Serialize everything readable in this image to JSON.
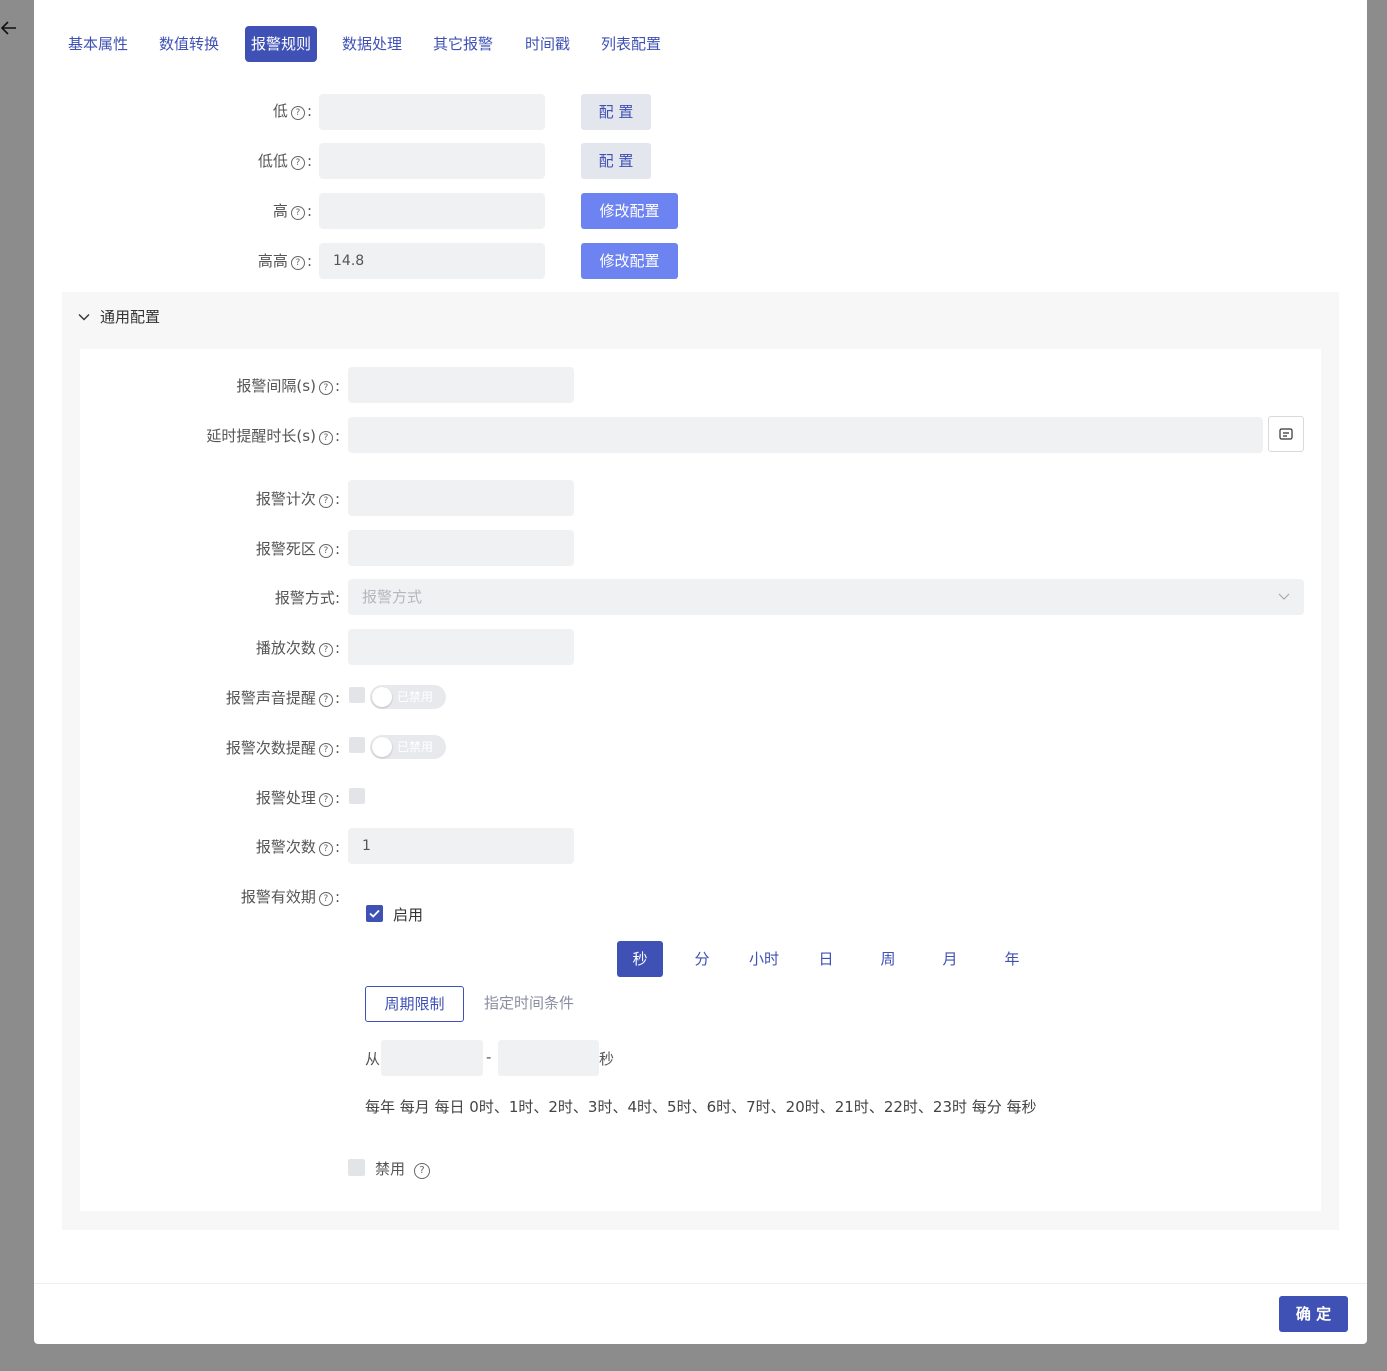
{
  "tabs": [
    "基本属性",
    "数值转换",
    "报警规则",
    "数据处理",
    "其它报警",
    "时间戳",
    "列表配置"
  ],
  "thresholds": [
    {
      "label": "低",
      "value": "",
      "button": "配 置"
    },
    {
      "label": "低低",
      "value": "",
      "button": "配 置"
    },
    {
      "label": "高",
      "value": "",
      "button": "修改配置"
    },
    {
      "label": "高高",
      "value": "14.8",
      "button": "修改配置"
    }
  ],
  "help_glyph": "?",
  "colon": ":",
  "general": {
    "title": "通用配置",
    "alarm_interval_label": "报警间隔(s)",
    "delay_remind_label": "延时提醒时长(s)",
    "alarm_count_label": "报警计次",
    "alarm_deadband_label": "报警死区",
    "alarm_method_label": "报警方式",
    "alarm_method_placeholder": "报警方式",
    "play_times_label": "播放次数",
    "sound_remind_label": "报警声音提醒",
    "sound_remind_switch": "已禁用",
    "times_remind_label": "报警次数提醒",
    "times_remind_switch": "已禁用",
    "alarm_handle_label": "报警处理",
    "alarm_times_label": "报警次数",
    "alarm_times_value": "1",
    "validity_label": "报警有效期",
    "enable_label": "启用",
    "units": [
      "秒",
      "分",
      "小时",
      "日",
      "周",
      "月",
      "年"
    ],
    "mode_period": "周期限制",
    "mode_time": "指定时间条件",
    "from_label": "从",
    "dash": "-",
    "sec_label": "秒",
    "summary": "每年 每月 每日 0时、1时、2时、3时、4时、5时、6时、7时、20时、21时、22时、23时 每分 每秒",
    "disable_label": "禁用"
  },
  "confirm_button": "确 定"
}
